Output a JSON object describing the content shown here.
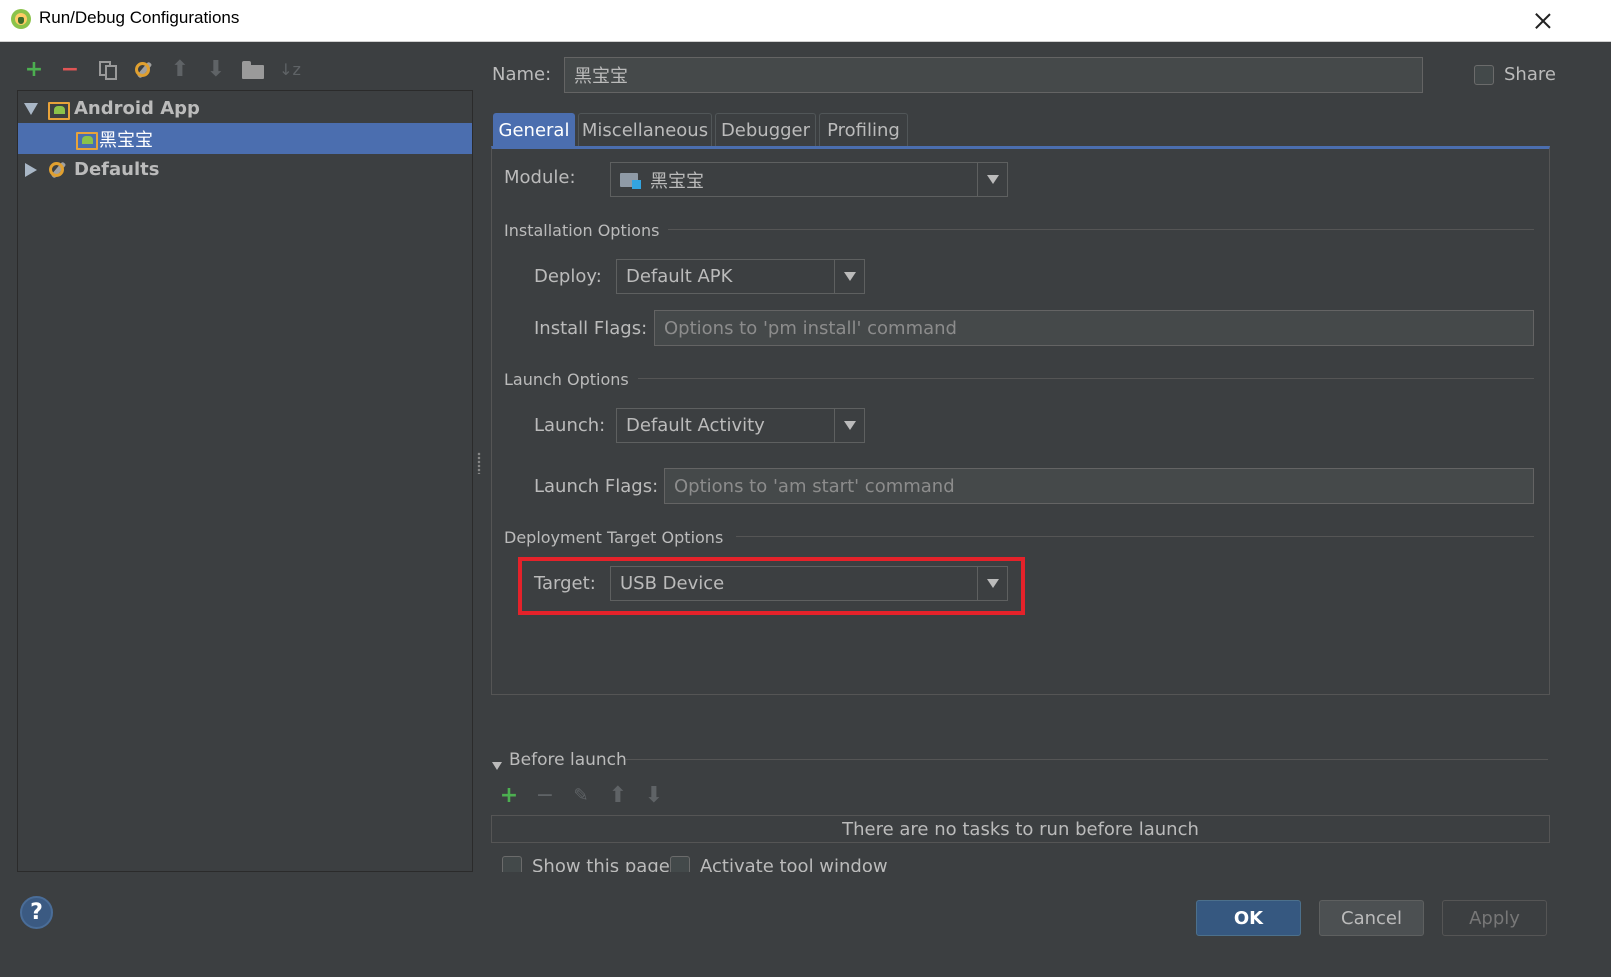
{
  "window": {
    "title": "Run/Debug Configurations"
  },
  "tree": {
    "groups": [
      {
        "label": "Android App",
        "expanded": true,
        "children": [
          {
            "label": "黑宝宝",
            "selected": true
          }
        ]
      },
      {
        "label": "Defaults",
        "expanded": false
      }
    ]
  },
  "name": {
    "label": "Name:",
    "value": "黑宝宝"
  },
  "share": {
    "label": "Share",
    "checked": false
  },
  "tabs": [
    {
      "label": "General",
      "active": true
    },
    {
      "label": "Miscellaneous",
      "active": false
    },
    {
      "label": "Debugger",
      "active": false
    },
    {
      "label": "Profiling",
      "active": false
    }
  ],
  "general": {
    "module": {
      "label": "Module:",
      "value": "黑宝宝"
    },
    "installation": {
      "title": "Installation Options",
      "deploy": {
        "label": "Deploy:",
        "value": "Default APK"
      },
      "install_flags": {
        "label": "Install Flags:",
        "placeholder": "Options to 'pm install' command"
      }
    },
    "launch": {
      "title": "Launch Options",
      "launch": {
        "label": "Launch:",
        "value": "Default Activity"
      },
      "launch_flags": {
        "label": "Launch Flags:",
        "placeholder": "Options to 'am start' command"
      }
    },
    "deployment": {
      "title": "Deployment Target Options",
      "target": {
        "label": "Target:",
        "value": "USB Device"
      }
    }
  },
  "before_launch": {
    "title": "Before launch",
    "empty_text": "There are no tasks to run before launch",
    "show_page": {
      "label": "Show this page",
      "checked": false
    },
    "activate_tool_window": {
      "label": "Activate tool window",
      "checked": false
    }
  },
  "buttons": {
    "ok": "OK",
    "cancel": "Cancel",
    "apply": "Apply"
  },
  "help": {
    "glyph": "?"
  },
  "colors": {
    "accent": "#4b6eaf",
    "highlight": "#e5222a",
    "add": "#4caf50",
    "remove": "#e05555"
  }
}
